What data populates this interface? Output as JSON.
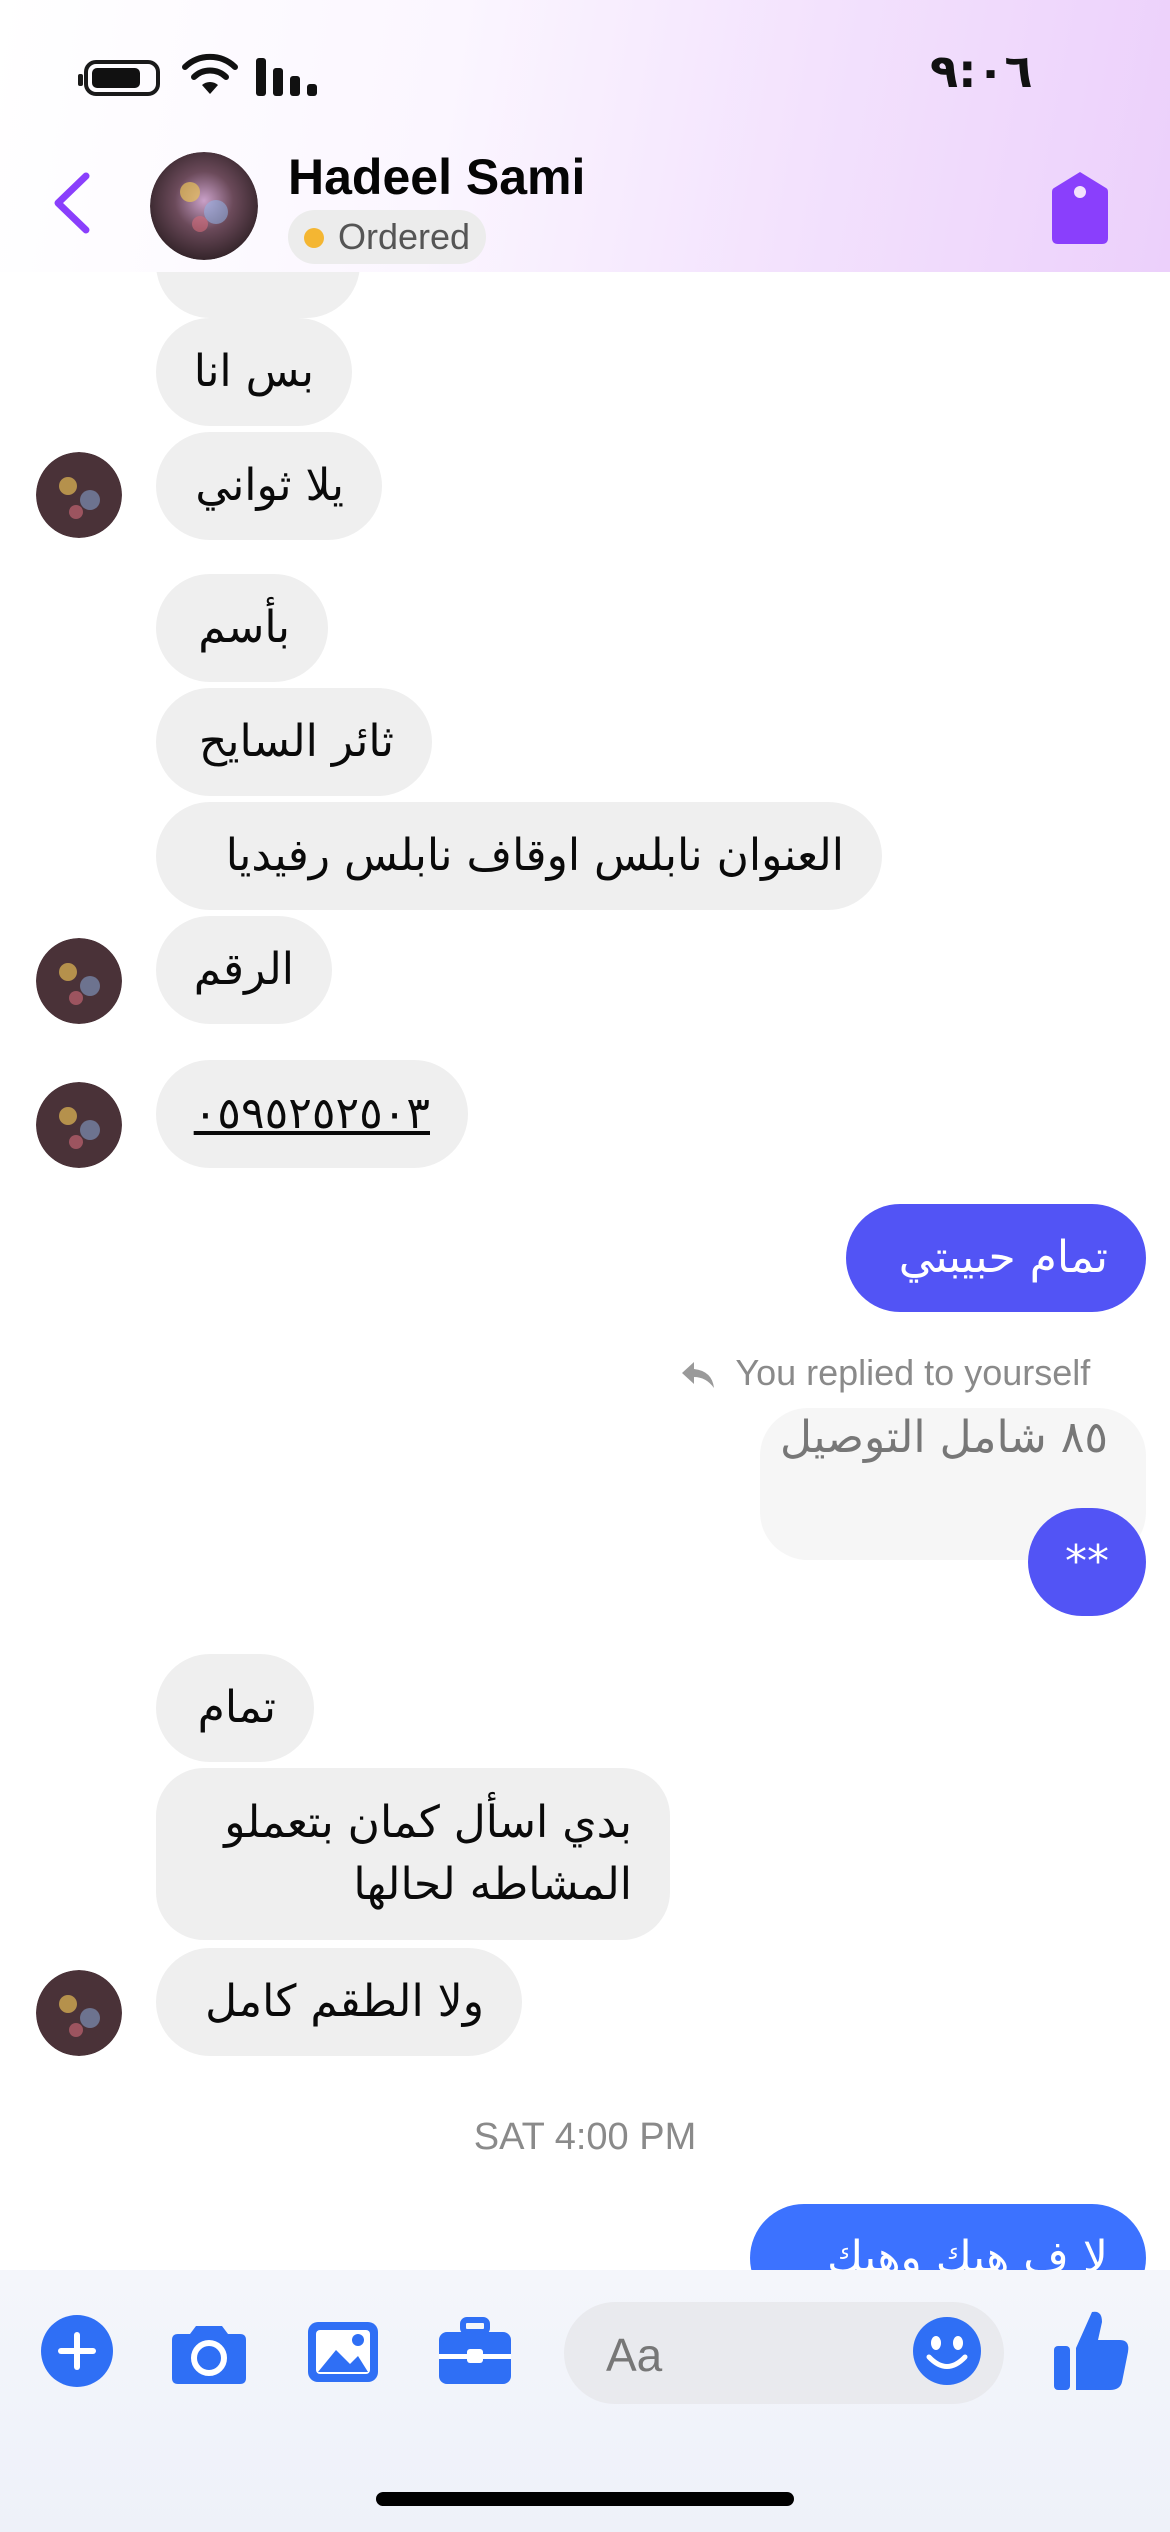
{
  "status_bar": {
    "time": "٩:٠٦"
  },
  "header": {
    "contact_name": "Hadeel Sami",
    "status_label": "Ordered",
    "status_color": "#f4b632",
    "accent_color": "#8a3ffc",
    "icons": [
      "back-chevron-icon",
      "tag-icon"
    ]
  },
  "messages": {
    "in_1": "بس انا",
    "in_2": "يلا ثواني",
    "in_3": "بأسم",
    "in_4": "ثائر السايح",
    "in_5": "العنوان نابلس اوقاف نابلس رفيديا",
    "in_6": "الرقم",
    "in_7": "٠٥٩٥٢٥٢٥٠٣",
    "out_1": "تمام حبيبتي",
    "reply_note": "You replied to yourself",
    "reply_quote": "٨٥ شامل التوصيل",
    "out_2": "**",
    "in_8": "تمام",
    "in_9": "بدي اسأل كمان بتعملو المشاطه لحالها",
    "in_10": "ولا الطقم كامل",
    "timestamp": "SAT 4:00 PM",
    "out_3": "لا ف هيك وهيك"
  },
  "composer": {
    "placeholder": "Aa",
    "icons": [
      "plus-icon",
      "camera-icon",
      "gallery-icon",
      "briefcase-icon",
      "emoji-icon",
      "like-icon"
    ],
    "icon_color": "#2f6ff5"
  }
}
